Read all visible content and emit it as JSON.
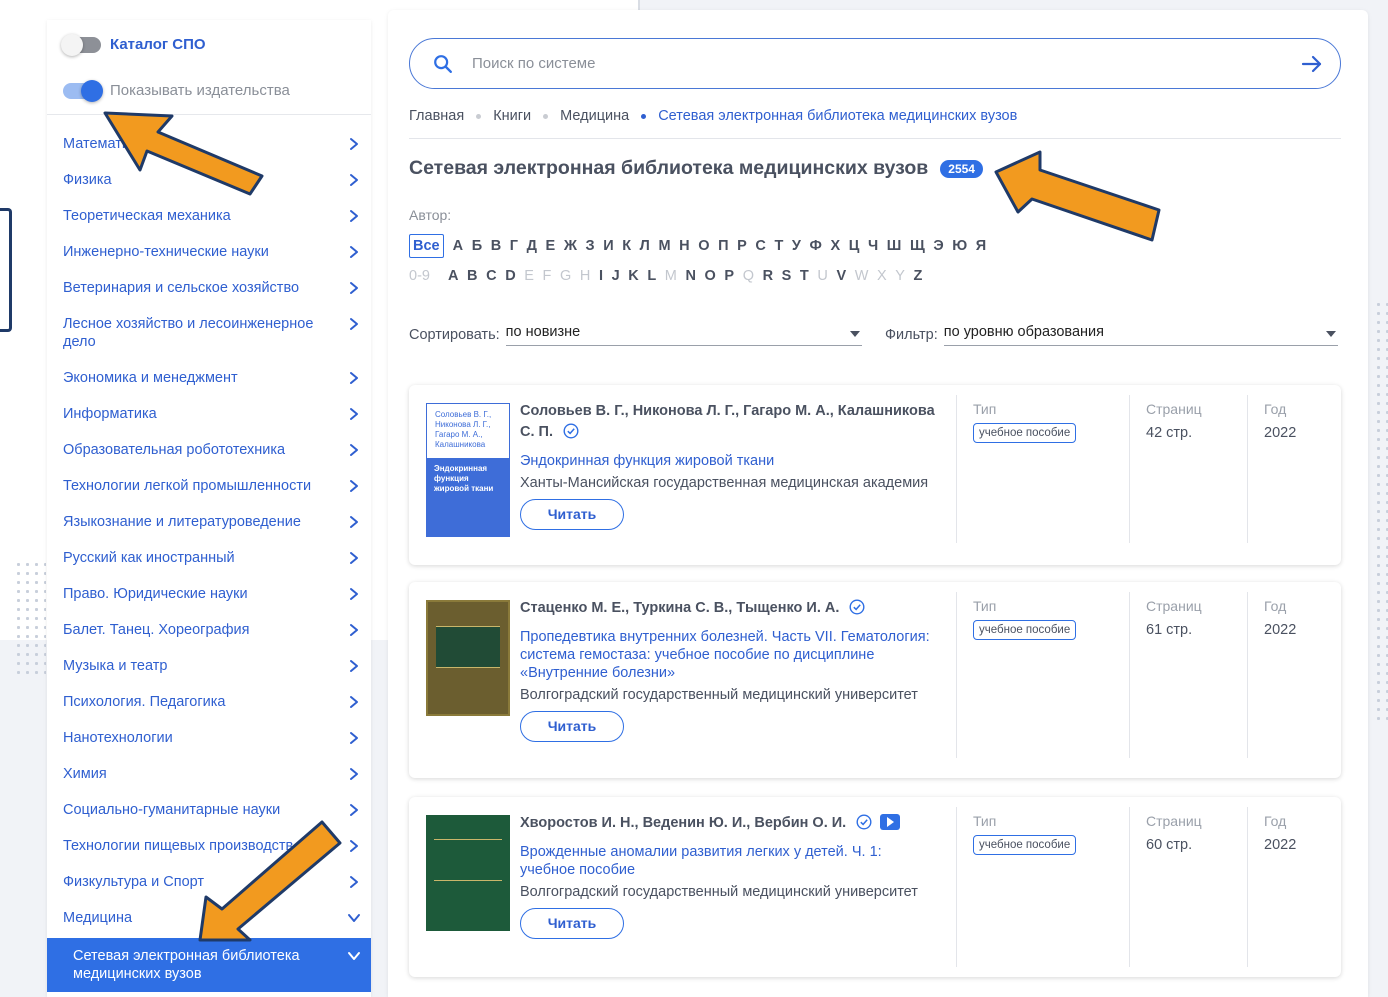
{
  "sidebar": {
    "toggles": [
      {
        "label": "Каталог СПО",
        "on": false
      },
      {
        "label": "Показывать издательства",
        "on": true
      }
    ],
    "categories": [
      "Математика",
      "Физика",
      "Теоретическая механика",
      "Инженерно-технические науки",
      "Ветеринария и сельское хозяйство",
      "Лесное хозяйство и лесоинженерное дело",
      "Экономика и менеджмент",
      "Информатика",
      "Образовательная робототехника",
      "Технологии легкой промышленности",
      "Языкознание и литературоведение",
      "Русский как иностранный",
      "Право. Юридические науки",
      "Балет. Танец. Хореография",
      "Музыка и театр",
      "Психология. Педагогика",
      "Нанотехнологии",
      "Химия",
      "Социально-гуманитарные науки",
      "Технологии пищевых производств",
      "Физкультура и Спорт",
      "Медицина"
    ],
    "active_subcategory": "Сетевая электронная библиотека медицинских вузов"
  },
  "search": {
    "placeholder": "Поиск по системе"
  },
  "breadcrumb": [
    "Главная",
    "Книги",
    "Медицина",
    "Сетевая электронная библиотека медицинских вузов"
  ],
  "page": {
    "title": "Сетевая электронная библиотека медицинских вузов",
    "count": "2554"
  },
  "author_filter": {
    "label": "Автор:",
    "all_label": "Все",
    "cyrillic": [
      "А",
      "Б",
      "В",
      "Г",
      "Д",
      "Е",
      "Ж",
      "З",
      "И",
      "К",
      "Л",
      "М",
      "Н",
      "О",
      "П",
      "Р",
      "С",
      "Т",
      "У",
      "Ф",
      "Х",
      "Ц",
      "Ч",
      "Ш",
      "Щ",
      "Э",
      "Ю",
      "Я"
    ],
    "latin": [
      {
        "l": "0-9",
        "dim": true
      },
      {
        "l": "A",
        "dim": false
      },
      {
        "l": "B",
        "dim": false
      },
      {
        "l": "C",
        "dim": false
      },
      {
        "l": "D",
        "dim": false
      },
      {
        "l": "E",
        "dim": true
      },
      {
        "l": "F",
        "dim": true
      },
      {
        "l": "G",
        "dim": true
      },
      {
        "l": "H",
        "dim": true
      },
      {
        "l": "I",
        "dim": false
      },
      {
        "l": "J",
        "dim": false
      },
      {
        "l": "K",
        "dim": false
      },
      {
        "l": "L",
        "dim": false
      },
      {
        "l": "M",
        "dim": true
      },
      {
        "l": "N",
        "dim": false
      },
      {
        "l": "O",
        "dim": false
      },
      {
        "l": "P",
        "dim": false
      },
      {
        "l": "Q",
        "dim": true
      },
      {
        "l": "R",
        "dim": false
      },
      {
        "l": "S",
        "dim": false
      },
      {
        "l": "T",
        "dim": false
      },
      {
        "l": "U",
        "dim": true
      },
      {
        "l": "V",
        "dim": false
      },
      {
        "l": "W",
        "dim": true
      },
      {
        "l": "X",
        "dim": true
      },
      {
        "l": "Y",
        "dim": true
      },
      {
        "l": "Z",
        "dim": false
      }
    ]
  },
  "sort": {
    "label": "Сортировать:",
    "value": "по новизне"
  },
  "filter": {
    "label": "Фильтр:",
    "value": "по уровню образования"
  },
  "column_heads": {
    "type": "Тип",
    "pages": "Страниц",
    "year": "Год"
  },
  "read_label": "Читать",
  "books": [
    {
      "authors": "Соловьев В. Г., Никонова Л. Г., Гагаро М. А., Калашникова С. П.",
      "title": "Эндокринная функция жировой ткани",
      "publisher": "Ханты-Мансийская государственная медицинская академия",
      "type": "учебное пособие",
      "pages": "42 стр.",
      "year": "2022",
      "cover_authors": "Соловьев В. Г., Никонова Л. Г., Гагаро М. А., Калашникова",
      "cover_title": "Эндокринная функция жировой ткани"
    },
    {
      "authors": "Стаценко М. Е., Туркина С. В., Тыщенко И. А.",
      "title": "Пропедевтика внутренних болезней. Часть VII. Гематология: система гемостаза: учебное пособие по дисциплине «Внутренние болезни»",
      "publisher": "Волгоградский государственный медицинский университет",
      "type": "учебное пособие",
      "pages": "61 стр.",
      "year": "2022"
    },
    {
      "authors": "Хворостов И. Н., Веденин Ю. И., Вербин О. И.",
      "title": "Врожденные аномалии развития легких у детей. Ч. 1: учебное пособие",
      "publisher": "Волгоградский государственный медицинский университет",
      "type": "учебное пособие",
      "pages": "60 стр.",
      "year": "2022"
    }
  ],
  "colors": {
    "accent": "#2f6fe4",
    "arrow": "#f29a1f",
    "arrow_outline": "#1f3a68"
  }
}
